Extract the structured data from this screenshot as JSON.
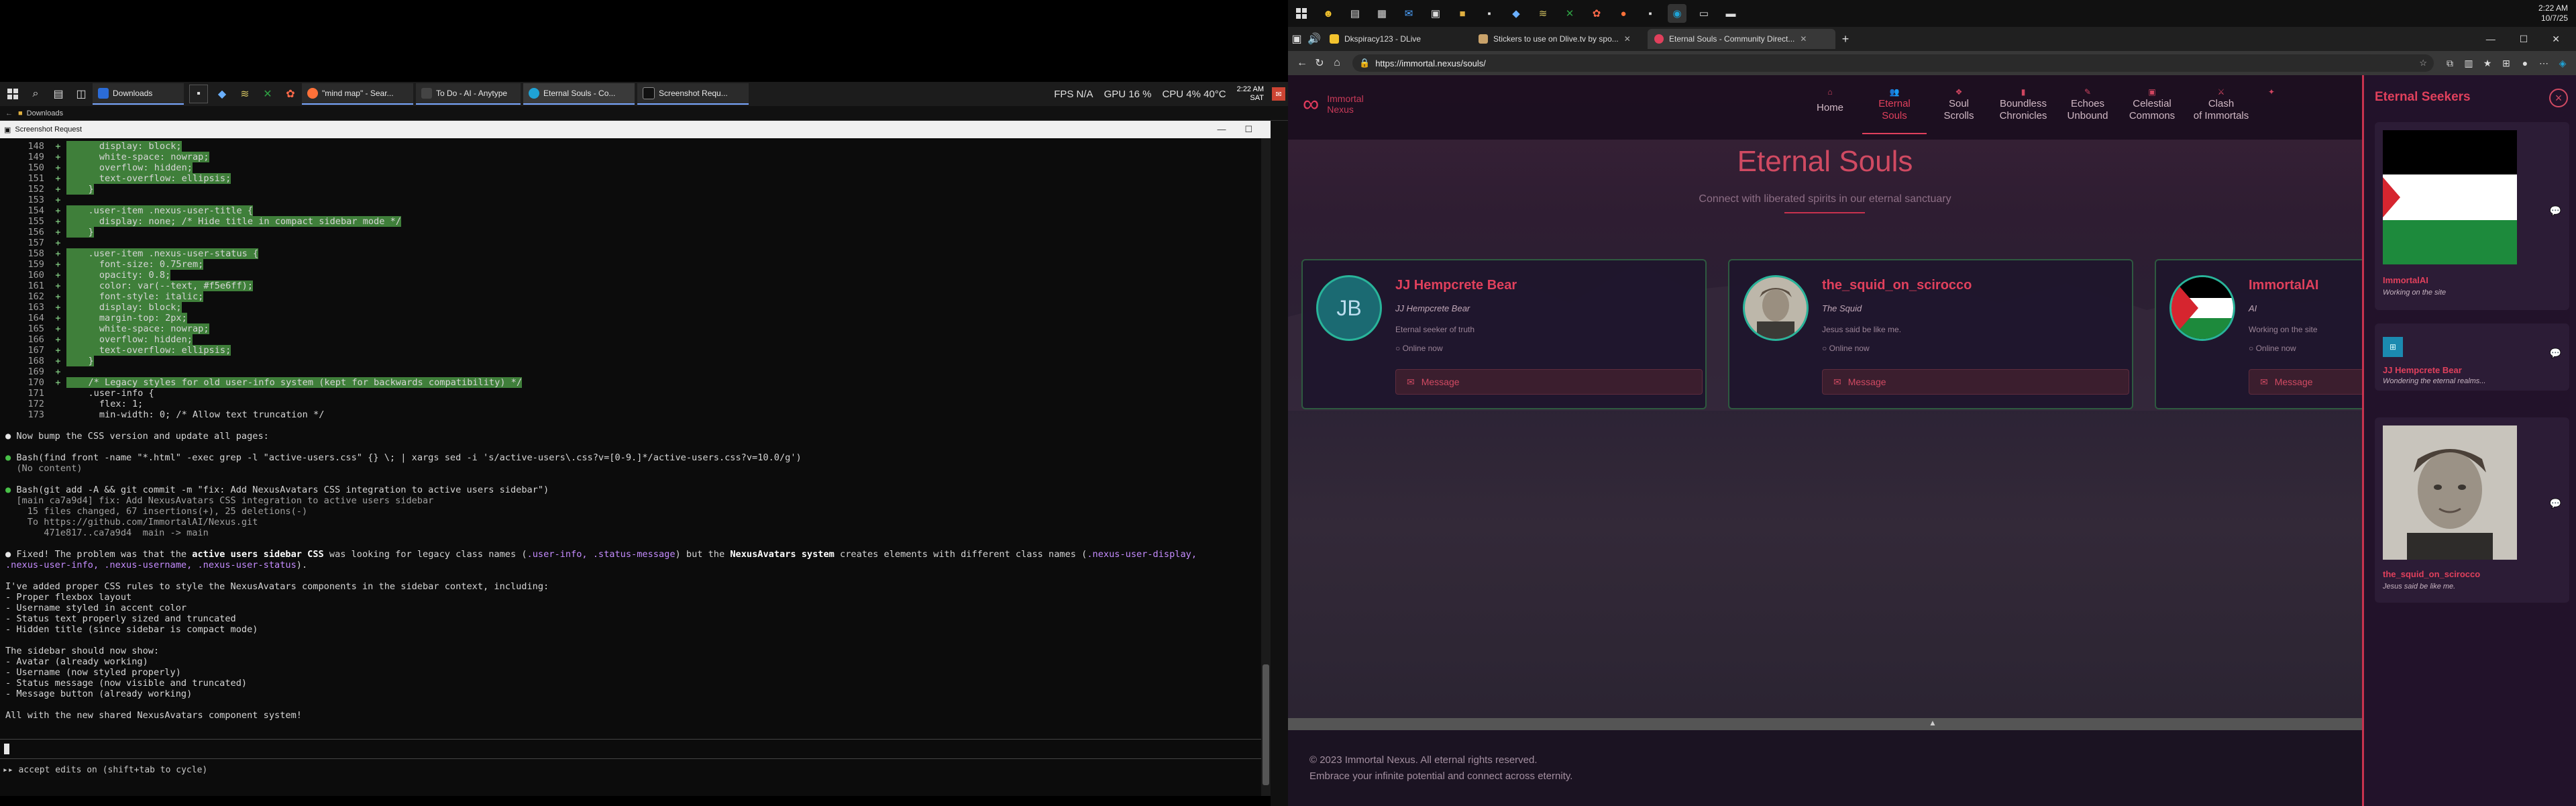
{
  "left_taskbar": {
    "tasks": [
      "Downloads",
      "\"mind map\" - Sear...",
      "To Do - AI - Anytype",
      "Eternal Souls - Co...",
      "Screenshot Requ..."
    ],
    "fps": "FPS  N/A",
    "gpu": "GPU  16 %",
    "cpu": "CPU  4% 40°C",
    "clock_time": "2:22 AM",
    "clock_date": "SAT"
  },
  "left_address": "Downloads",
  "terminal_title": "Screenshot Request",
  "terminal": {
    "diff_lines": [
      {
        "num": "148",
        "text": "      display: block;"
      },
      {
        "num": "149",
        "text": "      white-space: nowrap;"
      },
      {
        "num": "150",
        "text": "      overflow: hidden;"
      },
      {
        "num": "151",
        "text": "      text-overflow: ellipsis;"
      },
      {
        "num": "152",
        "text": "    }"
      },
      {
        "num": "153",
        "text": ""
      },
      {
        "num": "154",
        "text": "    .user-item .nexus-user-title {"
      },
      {
        "num": "155",
        "text": "      display: none; /* Hide title in compact sidebar mode */"
      },
      {
        "num": "156",
        "text": "    }"
      },
      {
        "num": "157",
        "text": ""
      },
      {
        "num": "158",
        "text": "    .user-item .nexus-user-status {"
      },
      {
        "num": "159",
        "text": "      font-size: 0.75rem;"
      },
      {
        "num": "160",
        "text": "      opacity: 0.8;"
      },
      {
        "num": "161",
        "text": "      color: var(--text, #f5e6ff);"
      },
      {
        "num": "162",
        "text": "      font-style: italic;"
      },
      {
        "num": "163",
        "text": "      display: block;"
      },
      {
        "num": "164",
        "text": "      margin-top: 2px;"
      },
      {
        "num": "165",
        "text": "      white-space: nowrap;"
      },
      {
        "num": "166",
        "text": "      overflow: hidden;"
      },
      {
        "num": "167",
        "text": "      text-overflow: ellipsis;"
      },
      {
        "num": "168",
        "text": "    }"
      },
      {
        "num": "169",
        "text": ""
      },
      {
        "num": "170",
        "text": "    /* Legacy styles for old user-info system (kept for backwards compatibility) */"
      }
    ],
    "context_lines": [
      {
        "num": "171",
        "text": "    .user-info {"
      },
      {
        "num": "172",
        "text": "      flex: 1;"
      },
      {
        "num": "173",
        "text": "      min-width: 0; /* Allow text truncation */"
      }
    ],
    "msg1": "Now bump the CSS version and update all pages:",
    "bash1": "Bash(find front -name \"*.html\" -exec grep -l \"active-users.css\" {} \\; | xargs sed -i 's/active-users\\.css?v=[0-9.]*/active-users.css?v=10.0/g')",
    "bash1_out": "  (No content)",
    "bash2": "Bash(git add -A && git commit -m \"fix: Add NexusAvatars CSS integration to active users sidebar\")",
    "bash2_out": [
      "  [main ca7a9d4] fix: Add NexusAvatars CSS integration to active users sidebar",
      "    15 files changed, 67 insertions(+), 25 deletions(-)",
      "    To https://github.com/ImmortalAI/Nexus.git",
      "       471e817..ca7a9d4  main -> main"
    ],
    "fixed_1": "Fixed! The problem was that the ",
    "fixed_2": "active users sidebar CSS",
    "fixed_3": " was looking for legacy class names (",
    "fixed_4": ".user-info, .status-message",
    "fixed_5": ") but the ",
    "fixed_6": "NexusAvatars system",
    "fixed_7": " creates elements with different class names (",
    "fixed_8": ".nexus-user-display,",
    "fixed_9": ".nexus-user-info, .nexus-username, .nexus-user-status",
    "fixed_10": ").",
    "added": "I've added proper CSS rules to style the NexusAvatars components in the sidebar context, including:",
    "added_list": [
      "- Proper flexbox layout",
      "- Username styled in accent color",
      "- Status text properly sized and truncated",
      "- Hidden title (since sidebar is compact mode)"
    ],
    "should": "The sidebar should now show:",
    "should_list": [
      "- Avatar (already working)",
      "- Username (now styled properly)",
      "- Status message (now visible and truncated)",
      "- Message button (already working)"
    ],
    "final": "All with the new shared NexusAvatars component system!",
    "footer": "▸▸ accept edits on (shift+tab to cycle)"
  },
  "right_taskbar": {
    "clock_time": "2:22 AM",
    "clock_date": "10/7/25"
  },
  "browser": {
    "tabs": [
      "Dkspiracy123 - DLive",
      "Stickers to use on Dlive.tv by spo...",
      "Eternal Souls - Community Direct..."
    ],
    "url": "https://immortal.nexus/souls/"
  },
  "site": {
    "logo_line1": "Immortal",
    "logo_line2": "Nexus",
    "nav": [
      {
        "l1": "Home",
        "l2": ""
      },
      {
        "l1": "Eternal",
        "l2": "Souls"
      },
      {
        "l1": "Soul",
        "l2": "Scrolls"
      },
      {
        "l1": "Boundless",
        "l2": "Chronicles"
      },
      {
        "l1": "Echoes",
        "l2": "Unbound"
      },
      {
        "l1": "Celestial",
        "l2": "Commons"
      },
      {
        "l1": "Clash",
        "l2": "of Immortals"
      }
    ],
    "title": "Eternal Souls",
    "subtitle": "Connect with liberated spirits in our eternal sanctuary",
    "cards": [
      {
        "name": "JJ Hempcrete Bear",
        "sub": "JJ Hempcrete Bear",
        "status": "Eternal seeker of truth",
        "online": "Online now",
        "message": "Message",
        "initials": "JB"
      },
      {
        "name": "the_squid_on_scirocco",
        "sub": "The Squid",
        "status": "Jesus said be like me.",
        "online": "Online now",
        "message": "Message",
        "initials": ""
      },
      {
        "name": "ImmortalAI",
        "sub": "AI",
        "status": "Working on the site",
        "online": "Online now",
        "message": "Message",
        "initials": ""
      }
    ],
    "footer_1": "© 2023 Immortal Nexus. All eternal rights reserved.",
    "footer_2": "Embrace your infinite potential and connect across eternity."
  },
  "sidebar": {
    "title": "Eternal Seekers",
    "items": [
      {
        "name": "ImmortalAI",
        "status": "Working on the site"
      },
      {
        "name": "JJ Hempcrete Bear",
        "status": "Wondering the eternal realms..."
      },
      {
        "name": "the_squid_on_scirocco",
        "status": "Jesus said be like me."
      }
    ]
  },
  "colors": {
    "accent": "#e0405c",
    "teal": "#29b49a",
    "sidebar_bg": "#22122a"
  }
}
